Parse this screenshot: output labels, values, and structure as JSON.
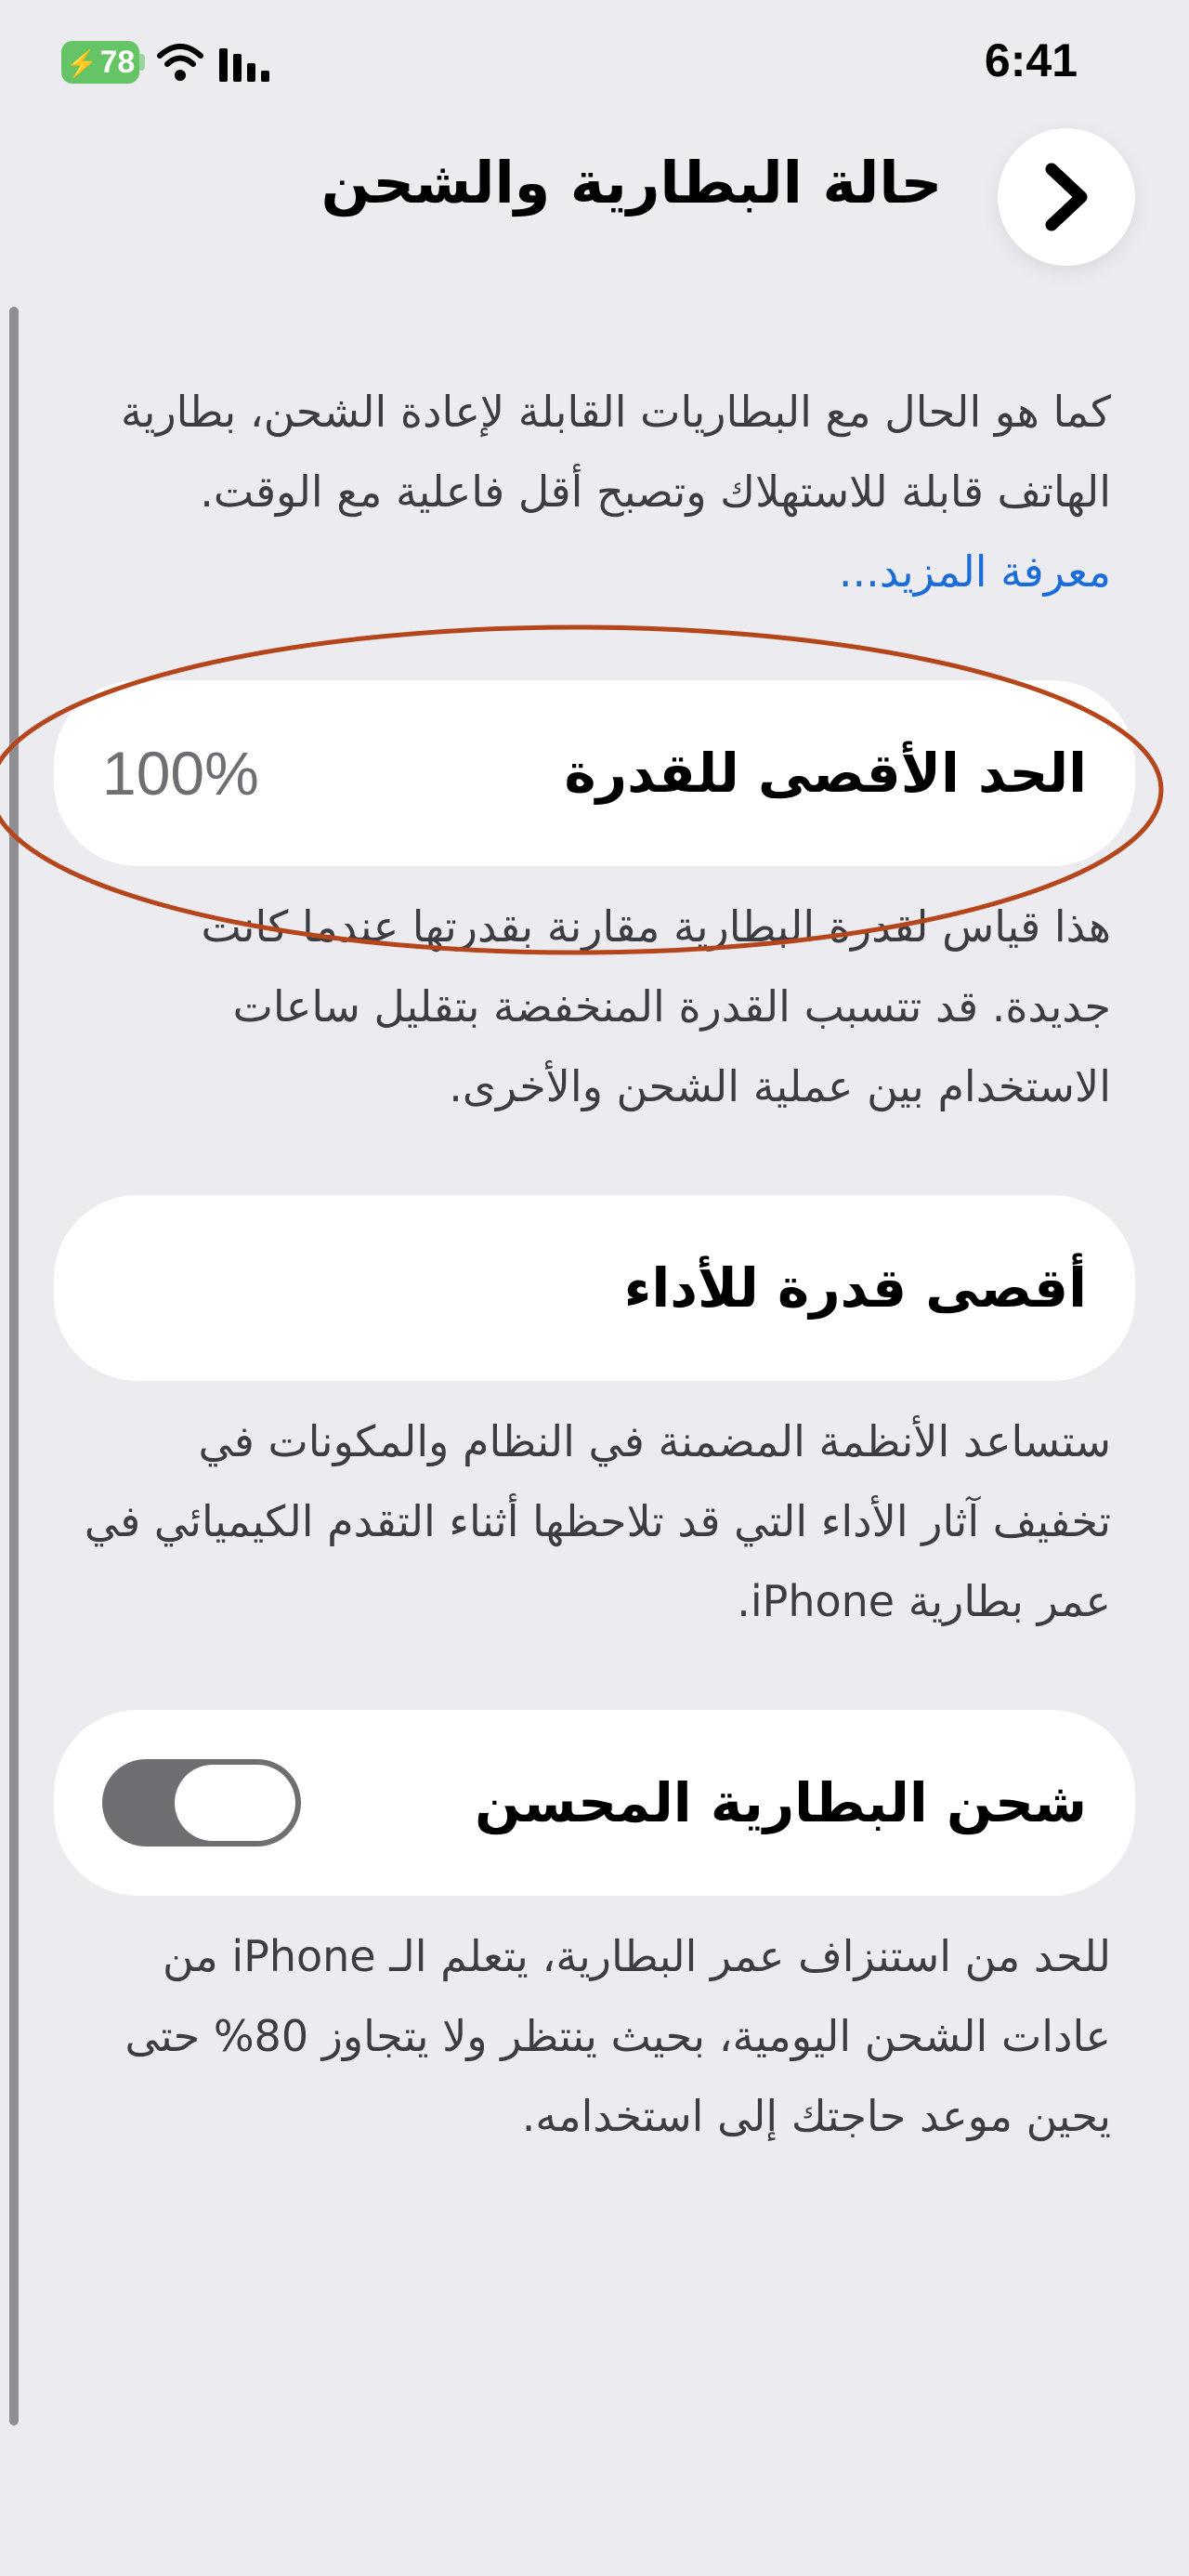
{
  "status_bar": {
    "battery_level": "78",
    "time": "6:41",
    "battery_color": "#65c466"
  },
  "nav": {
    "title": "حالة البطارية والشحن",
    "back_icon": "chevron-right-icon"
  },
  "intro": {
    "text": "كما هو الحال مع البطاريات القابلة لإعادة الشحن، بطارية الهاتف قابلة للاستهلاك وتصبح أقل فاعلية مع الوقت.",
    "link": "معرفة المزيد..."
  },
  "maximum_capacity": {
    "label": "الحد الأقصى للقدرة",
    "value": "100%",
    "description": "هذا قياس لقدرة البطارية مقارنة بقدرتها عندما كانت جديدة. قد تتسبب القدرة المنخفضة بتقليل ساعات الاستخدام بين عملية الشحن والأخرى."
  },
  "peak_performance": {
    "label": "أقصى قدرة للأداء",
    "description": "ستساعد الأنظمة المضمنة في النظام والمكونات في تخفيف آثار الأداء التي قد تلاحظها أثناء التقدم الكيميائي في عمر بطارية iPhone."
  },
  "optimized_charging": {
    "label": "شحن البطارية المحسن",
    "enabled": false,
    "description": "للحد من استنزاف عمر البطارية، يتعلم الـ iPhone من عادات الشحن اليومية، بحيث ينتظر ولا يتجاوز 80% حتى يحين موعد حاجتك إلى استخدامه."
  },
  "annotation_color": "#b5451b",
  "link_color": "#1a6dd8"
}
